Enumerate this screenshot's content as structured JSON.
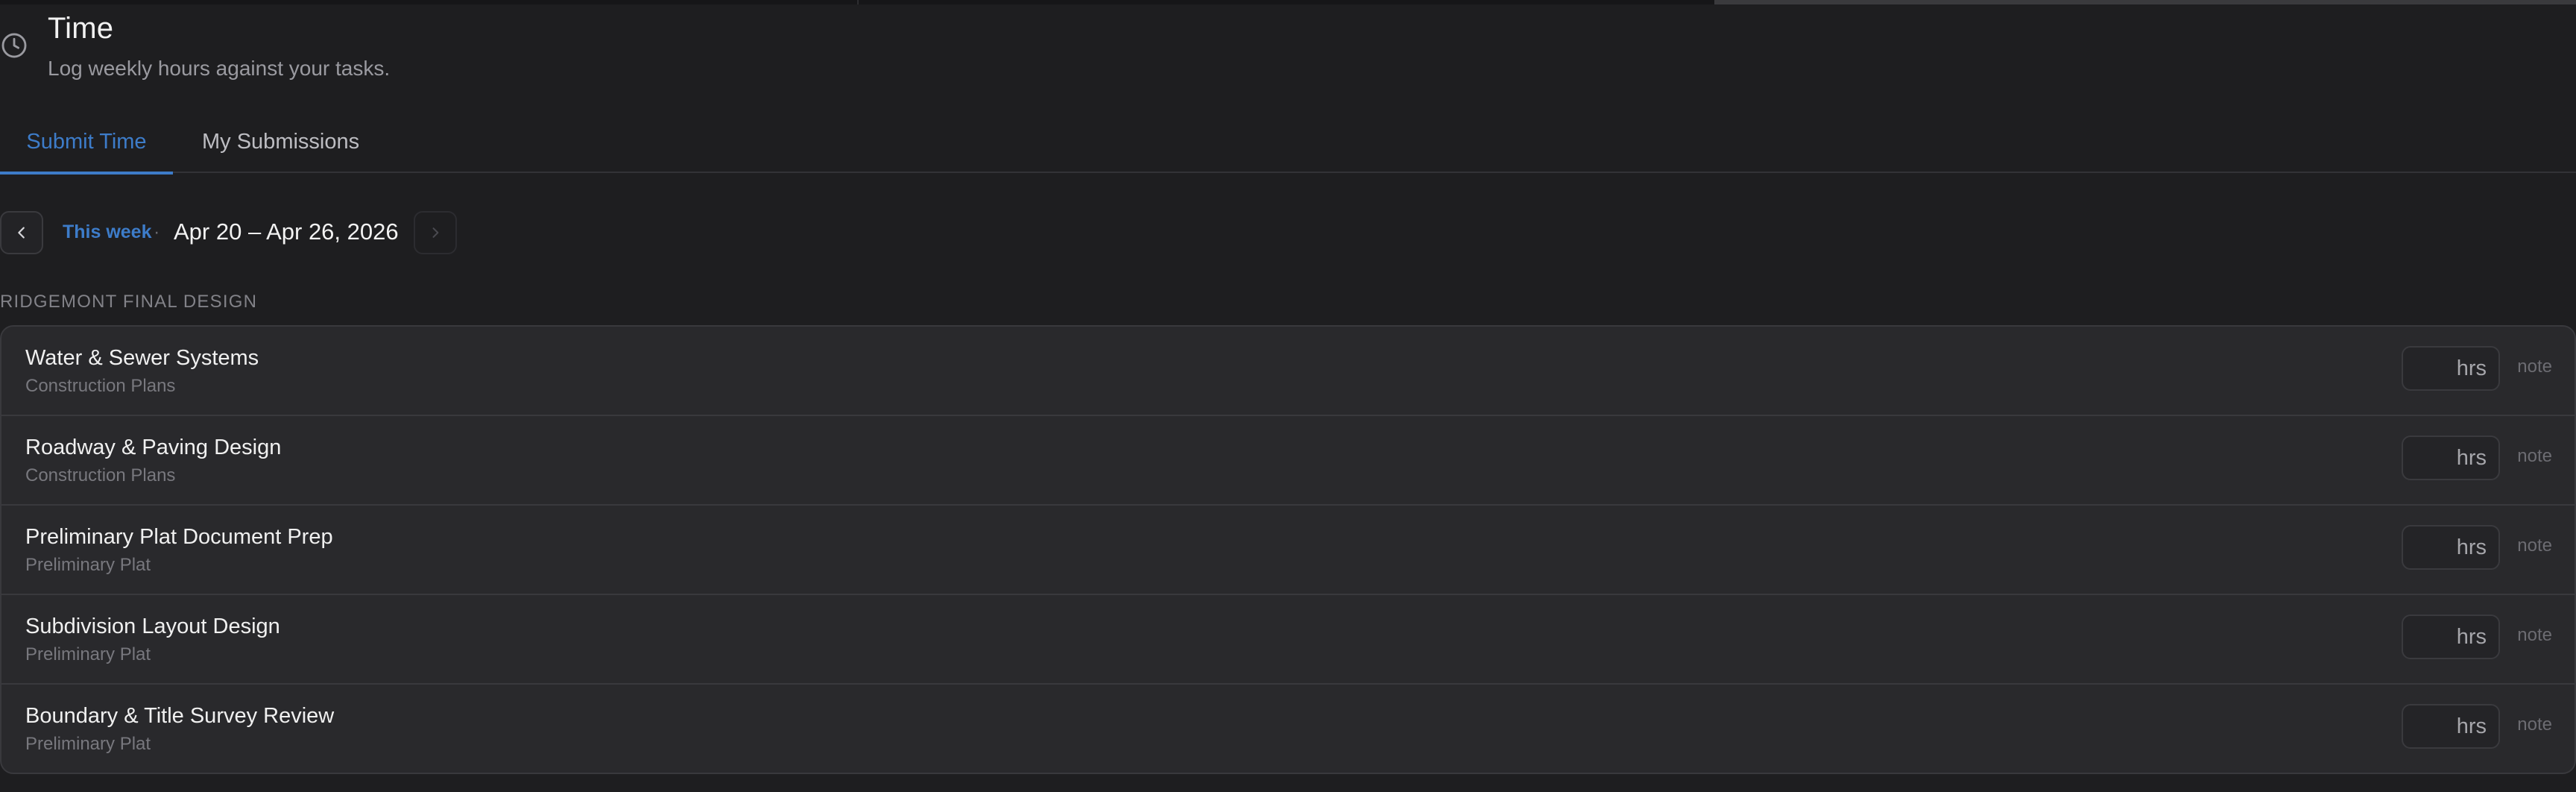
{
  "header": {
    "icon": "clock-icon",
    "title": "Time",
    "subtitle": "Log weekly hours against your tasks."
  },
  "tabs": [
    {
      "label": "Submit Time",
      "active": true
    },
    {
      "label": "My Submissions",
      "active": false
    }
  ],
  "week": {
    "this_week_label": "This week",
    "separator": "·",
    "range": "Apr 20 – Apr 26, 2026",
    "prev_icon": "chevron-left-icon",
    "next_icon": "chevron-right-icon"
  },
  "project": {
    "name": "RIDGEMONT FINAL DESIGN",
    "tasks": [
      {
        "name": "Water & Sewer Systems",
        "phase": "Construction Plans",
        "hours_unit": "hrs",
        "note_label": "note"
      },
      {
        "name": "Roadway & Paving Design",
        "phase": "Construction Plans",
        "hours_unit": "hrs",
        "note_label": "note"
      },
      {
        "name": "Preliminary Plat Document Prep",
        "phase": "Preliminary Plat",
        "hours_unit": "hrs",
        "note_label": "note"
      },
      {
        "name": "Subdivision Layout Design",
        "phase": "Preliminary Plat",
        "hours_unit": "hrs",
        "note_label": "note"
      },
      {
        "name": "Boundary & Title Survey Review",
        "phase": "Preliminary Plat",
        "hours_unit": "hrs",
        "note_label": "note"
      }
    ]
  },
  "colors": {
    "background": "#1e1e20",
    "accent": "#3d7cc9",
    "card": "#29292c"
  }
}
